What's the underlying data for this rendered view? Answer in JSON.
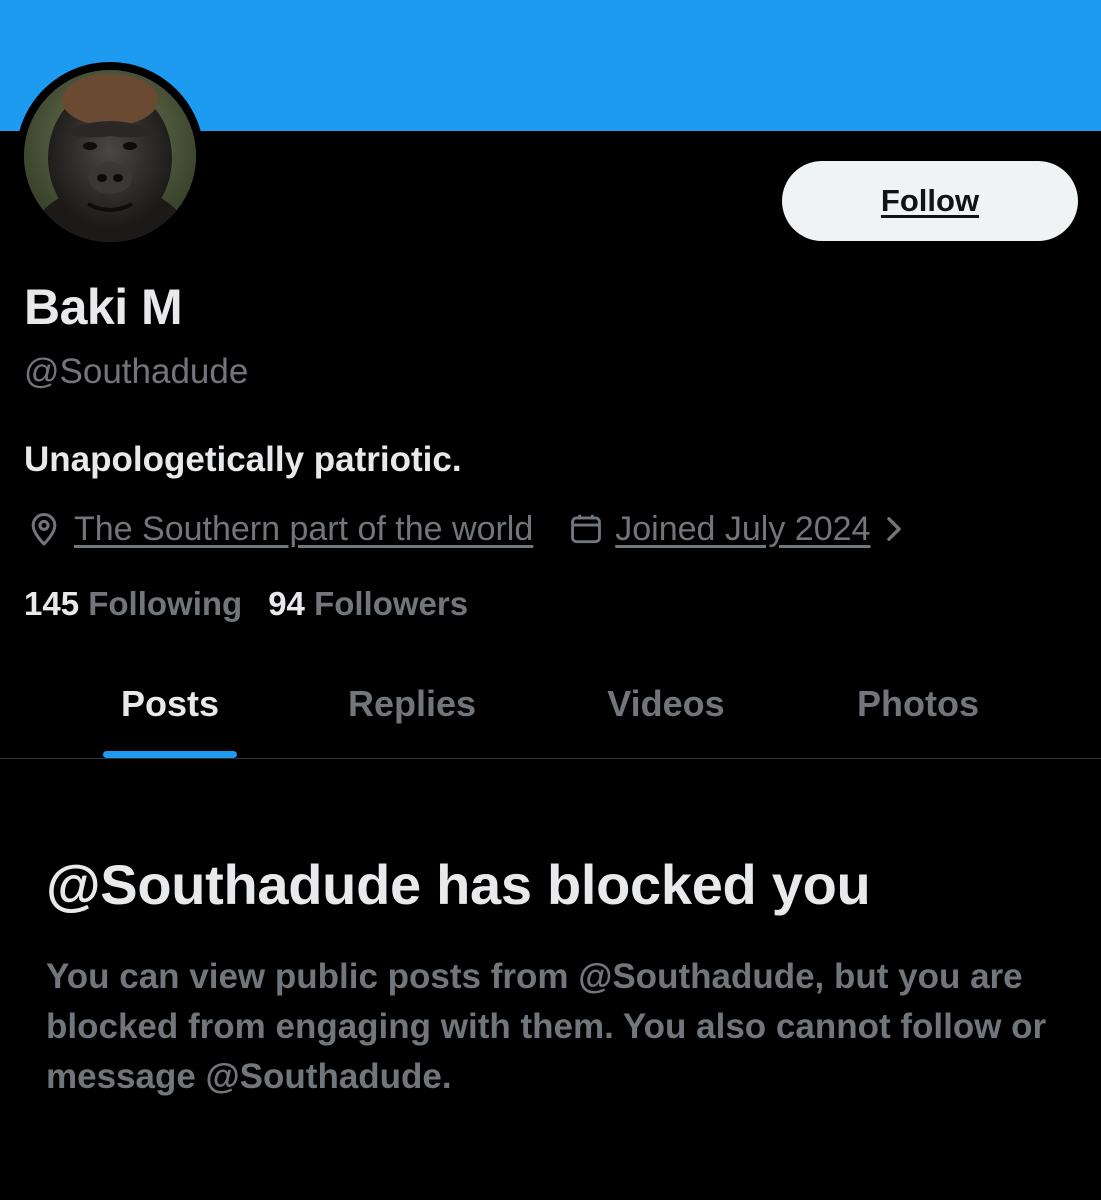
{
  "profile": {
    "display_name": "Baki M",
    "handle": "@Southadude",
    "bio": "Unapologetically patriotic.",
    "location": "The Southern part of the world",
    "joined": "Joined July 2024",
    "following_count": "145",
    "following_label": "Following",
    "followers_count": "94",
    "followers_label": "Followers"
  },
  "actions": {
    "follow_label": "Follow"
  },
  "tabs": [
    {
      "label": "Posts",
      "active": true
    },
    {
      "label": "Replies",
      "active": false
    },
    {
      "label": "Videos",
      "active": false
    },
    {
      "label": "Photos",
      "active": false
    }
  ],
  "blocked": {
    "title": "@Southadude has blocked you",
    "description": "You can view public posts from @Southadude, but you are blocked from engaging with them. You also cannot follow or message @Southadude."
  },
  "icons": {
    "location": "location-pin-icon",
    "joined": "calendar-icon",
    "more": "chevron-right-icon"
  },
  "colors": {
    "banner": "#1d9bf0",
    "background": "#000000",
    "primary_text": "#e7e9ea",
    "secondary_text": "#71767b",
    "accent": "#1d9bf0",
    "follow_button_bg": "#eff3f4"
  }
}
